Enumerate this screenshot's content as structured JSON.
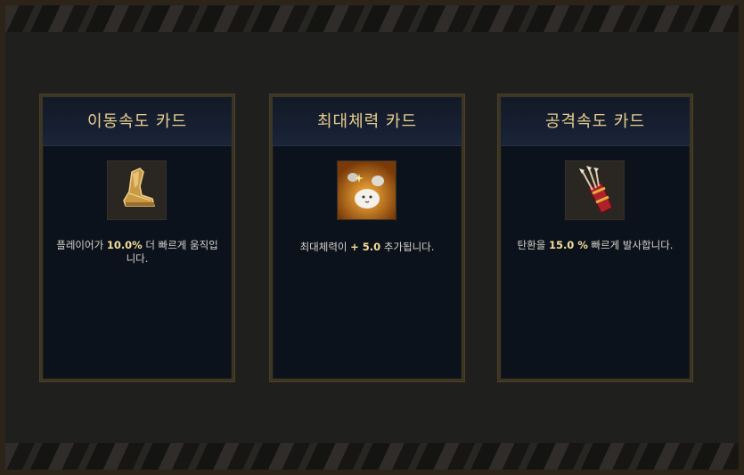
{
  "cards": [
    {
      "title": "이동속도 카드",
      "icon": "boot-icon",
      "desc_pre": "플레이어가 ",
      "desc_value": "10.0%",
      "desc_post": " 더 빠르게 움직입니다."
    },
    {
      "title": "최대체력 카드",
      "icon": "health-blob-icon",
      "desc_pre": "최대체력이 ",
      "desc_value": "+ 5.0",
      "desc_post": " 추가됩니다."
    },
    {
      "title": "공격속도 카드",
      "icon": "quiver-icon",
      "desc_pre": "탄환을 ",
      "desc_value": "15.0 %",
      "desc_post": " 빠르게 발사합니다."
    }
  ],
  "colors": {
    "title": "#e8cf8e",
    "highlight": "#f4df9a",
    "card_bg": "#0c121c",
    "border": "#3d3523"
  }
}
